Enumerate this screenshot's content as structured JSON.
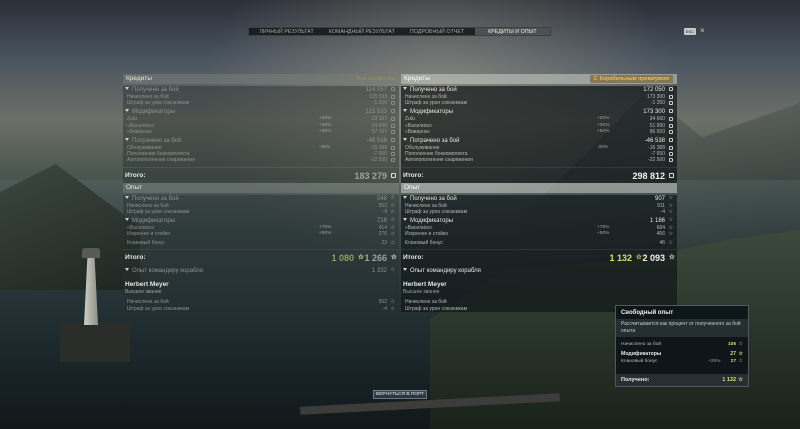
{
  "nav": {
    "tabs": [
      "ЛИЧНЫЙ РЕЗУЛЬТАТ",
      "КОМАНДНЫЙ РЕЗУЛЬТАТ",
      "ПОДРОБНЫЙ ОТЧЕТ",
      "КРЕДИТЫ И ОПЫТ"
    ],
    "active_index": 3,
    "ext_label": "ESC"
  },
  "left": {
    "credits": {
      "title": "Кредиты",
      "tag": "Без премиума",
      "earned": {
        "label": "Получено за бой",
        "value": "114 057"
      },
      "earned_rows": [
        {
          "label": "Начислено за бой",
          "value": "115 533"
        },
        {
          "label": "Штраф за урон союзникам",
          "value": "-1 250"
        }
      ],
      "mods": {
        "label": "Модификаторы",
        "value": "115 533"
      },
      "mods_rows": [
        {
          "label": "Zulu",
          "pct": "+20%",
          "value": "23 107"
        },
        {
          "label": "«Василиск»",
          "pct": "+30%",
          "value": "34 660"
        },
        {
          "label": "«Виверна»",
          "pct": "+50%",
          "value": "57 767"
        }
      ],
      "spent": {
        "label": "Потрачено за бой",
        "value": "-46 538"
      },
      "spent_rows": [
        {
          "label": "Обслуживание",
          "pct": "-25%",
          "value": "-16 388"
        },
        {
          "label": "Пополнение боекомплекта",
          "pct": "",
          "value": "-7 650"
        },
        {
          "label": "Автопополнение снаряжения",
          "pct": "",
          "value": "-22 500"
        }
      ],
      "total_label": "Итого:",
      "total": "183 279"
    },
    "exp": {
      "title": "Опыт",
      "earned": {
        "label": "Получено за бой",
        "value": "548"
      },
      "earned_rows": [
        {
          "label": "Начислено за бой",
          "value": "552"
        },
        {
          "label": "Штраф за урон союзникам",
          "value": "-4"
        }
      ],
      "mods": {
        "label": "Модификаторы",
        "value": "718"
      },
      "mods_rows": [
        {
          "label": "«Василиск»",
          "pct": "+75%",
          "value": "414"
        },
        {
          "label": "Искренне и стойко",
          "pct": "+50%",
          "value": "276"
        }
      ],
      "clan": {
        "label": "Клановый бонус",
        "value": "23"
      },
      "total_label": "Итого:",
      "free_total": "1 080",
      "total": "1 266"
    },
    "cmdr": {
      "title": "Опыт командиру корабля",
      "value": "1 332",
      "name": "Herbert Meyer",
      "rank": "Высшее звание",
      "rows": [
        {
          "label": "Начислено за бой",
          "value": "552"
        },
        {
          "label": "Штраф за урон союзникам",
          "value": "-4"
        }
      ]
    }
  },
  "right": {
    "credits": {
      "title": "Кредиты",
      "tag": "С Корабельным премиумом",
      "earned": {
        "label": "Получено за бой",
        "value": "172 050"
      },
      "earned_rows": [
        {
          "label": "Начислено за бой",
          "value": "173 300"
        },
        {
          "label": "Штраф за урон союзникам",
          "value": "-1 250"
        }
      ],
      "mods": {
        "label": "Модификаторы",
        "value": "173 300"
      },
      "mods_rows": [
        {
          "label": "Zulu",
          "pct": "+20%",
          "value": "34 660"
        },
        {
          "label": "«Василиск»",
          "pct": "+30%",
          "value": "51 990"
        },
        {
          "label": "«Виверна»",
          "pct": "+50%",
          "value": "86 650"
        }
      ],
      "spent": {
        "label": "Потрачено за бой",
        "value": "-46 538"
      },
      "spent_rows": [
        {
          "label": "Обслуживание",
          "pct": "-25%",
          "value": "-16 388"
        },
        {
          "label": "Пополнение боекомплекта",
          "pct": "",
          "value": "-7 650"
        },
        {
          "label": "Автопополнение снаряжения",
          "pct": "",
          "value": "-22 500"
        }
      ],
      "total_label": "Итого:",
      "total": "298 812"
    },
    "exp": {
      "title": "Опыт",
      "earned": {
        "label": "Получено за бой",
        "value": "907"
      },
      "earned_rows": [
        {
          "label": "Начислено за бой",
          "value": "911"
        },
        {
          "label": "Штраф за урон союзникам",
          "value": "-4"
        }
      ],
      "mods": {
        "label": "Модификаторы",
        "value": "1 186"
      },
      "mods_rows": [
        {
          "label": "«Василиск»",
          "pct": "+75%",
          "value": "684"
        },
        {
          "label": "Искренне и стойко",
          "pct": "+50%",
          "value": "456"
        }
      ],
      "clan": {
        "label": "Клановый бонус",
        "value": "46"
      },
      "total_label": "Итого:",
      "free_total": "1 132",
      "total": "2 093"
    },
    "cmdr": {
      "title": "Опыт командиру корабля",
      "name": "Herbert Meyer",
      "rank": "Высшее звание",
      "rows": [
        {
          "label": "Начислено за бой",
          "value": "911"
        },
        {
          "label": "Штраф за урон союзникам",
          "value": "-4"
        }
      ]
    }
  },
  "tooltip": {
    "title": "Свободный опыт",
    "desc": "Рассчитывается как процент от полученного за бой опыта",
    "earned": {
      "label": "Начислено за бой",
      "value": "105"
    },
    "mods": {
      "label": "Модификаторы",
      "value": "27"
    },
    "clan": {
      "label": "Клановый бонус",
      "pct": "+25%",
      "value": "27"
    },
    "total": {
      "label": "Получено:",
      "value": "1 132"
    }
  },
  "back_button": "ВЕРНУТЬСЯ В ПОРТ",
  "colors": {
    "accent_free_exp": "#cfe07a",
    "premium_gold": "#ffd455"
  }
}
